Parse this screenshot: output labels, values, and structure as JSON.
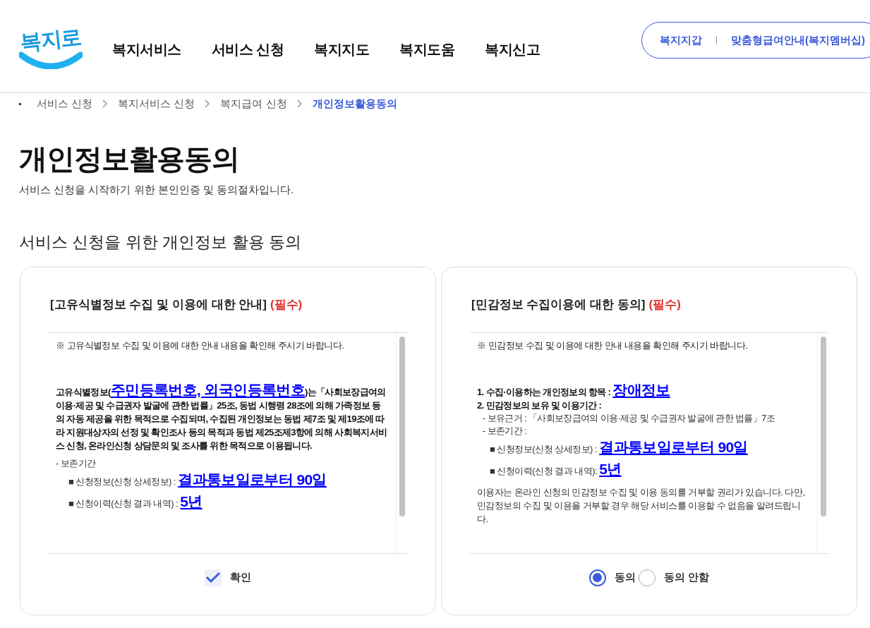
{
  "header": {
    "logo": "복지로",
    "nav": [
      "복지서비스",
      "서비스 신청",
      "복지지도",
      "복지도움",
      "복지신고"
    ],
    "quick_links": [
      "복지지갑",
      "맞춤형급여안내(복지멤버십)"
    ]
  },
  "breadcrumb": [
    {
      "label": "서비스 신청",
      "selected": false
    },
    {
      "label": "복지서비스 신청",
      "selected": false
    },
    {
      "label": "복지급여 신청",
      "selected": false
    },
    {
      "label": "개인정보활용동의",
      "selected": true
    }
  ],
  "page_title": "개인정보활용동의",
  "subtitle": "서비스 신청을 시작하기 위한 본인인증 및 동의절차입니다.",
  "section_title": "서비스 신청을 위한 개인정보 활용 동의",
  "panels": [
    {
      "title": "[고유식별정보 수집 및 이용에 대한 안내]",
      "required": "(필수)",
      "blocks": [
        {
          "kind": "notice",
          "parts": [
            {
              "text": "※ 고유식별정보 수집 및 이용에 대한 안내 내용을 확인해 주시기 바랍니다.",
              "link": false
            }
          ]
        },
        {
          "kind": "strong",
          "parts": [
            {
              "text": "고유식별정보(",
              "link": false
            },
            {
              "text": "주민등록번호, 외국인등록번호",
              "link": true
            },
            {
              "text": ")는「사회보장급여의 이용·제공 및 수급권자 발굴에 관한 법률」25조, 동법 시행령 28조에 의해 가족정보 등의 자동 제공을 위한 목적으로 수집되며, 수집된 개인정보는 동법 제7조 및 제19조에 따라 지원대상자의 선정 및 확인조사 등의 목적과 동법 제25조제3항에 의해 사회복지서비스 신청, 온라인신청 상담문의 및 조사를 위한 목적으로 이용됩니다.",
              "link": false
            }
          ]
        },
        {
          "kind": "plain",
          "parts": [
            {
              "text": "- 보존기간",
              "link": false
            }
          ]
        },
        {
          "kind": "item",
          "parts": [
            {
              "text": "■ 신청정보(신청 상세정보) : ",
              "link": false
            },
            {
              "text": "결과통보일로부터 90일",
              "link": true
            }
          ]
        },
        {
          "kind": "item",
          "parts": [
            {
              "text": "■ 신청이력(신청 결과 내역) : ",
              "link": false
            },
            {
              "text": "5년",
              "link": true
            }
          ]
        }
      ],
      "control": {
        "kind": "checkbox",
        "options": [
          {
            "label": "확인",
            "selected": true
          }
        ]
      }
    },
    {
      "title": "[민감정보 수집이용에 대한 동의]",
      "required": "(필수)",
      "blocks": [
        {
          "kind": "notice",
          "parts": [
            {
              "text": "※ 민감정보 수집 및 이용에 대한 안내 내용을 확인해 주시기 바랍니다.",
              "link": false
            }
          ]
        },
        {
          "kind": "strong",
          "parts": [
            {
              "text": "1. 수집·이용하는 개인정보의 항목 : ",
              "link": false
            },
            {
              "text": "장애정보",
              "link": true
            }
          ]
        },
        {
          "kind": "strong",
          "parts": [
            {
              "text": "2. 민감정보의 보유 및 이용기간 :",
              "link": false
            }
          ]
        },
        {
          "kind": "sub",
          "parts": [
            {
              "text": "- 보유근거 : 「사회보장급여의 이용·제공 및 수급권자 발굴에 관한 법률」7조",
              "link": false
            }
          ]
        },
        {
          "kind": "sub",
          "parts": [
            {
              "text": "- 보존기간 :",
              "link": false
            }
          ]
        },
        {
          "kind": "item",
          "parts": [
            {
              "text": "■ 신청정보(신청 상세정보) : ",
              "link": false
            },
            {
              "text": "결과통보일로부터 90일",
              "link": true
            }
          ]
        },
        {
          "kind": "item",
          "parts": [
            {
              "text": "■ 신청이력(신청 결과 내역): ",
              "link": false
            },
            {
              "text": "5년",
              "link": true
            }
          ]
        },
        {
          "kind": "plain",
          "parts": [
            {
              "text": "이용자는 온라인 신청의 민감정보 수집 및 이용 동의를 거부할 권리가 있습니다. 다만, 민감정보의 수집 및 이용을 거부할 경우 해당 서비스를 이용할 수 없음을 알려드립니다.",
              "link": false
            }
          ]
        }
      ],
      "control": {
        "kind": "radio",
        "options": [
          {
            "label": "동의",
            "selected": true
          },
          {
            "label": "동의 안함",
            "selected": false
          }
        ]
      }
    }
  ]
}
